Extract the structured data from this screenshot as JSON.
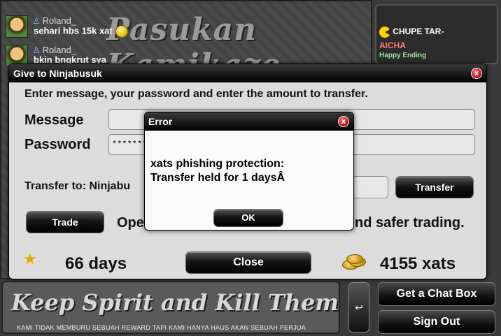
{
  "chat": {
    "banner": "Pasukan Kamikaze",
    "messages": [
      {
        "name": "Roland_",
        "text": "sehari hbs 15k xat"
      },
      {
        "name": "Roland_",
        "text": "bkin bngkrut sya"
      }
    ]
  },
  "user_list": {
    "row1": "CHUPE  TAR-",
    "row2": "AICHA",
    "row3": "Happy Ending"
  },
  "bottom": {
    "banner": "Keep Spirit and Kill Them AlL",
    "strip": "KAMI TIDAK MEMBURU  SEBUAH REWARD TAPI KAMI HANYA HAUS AKAN SEBUAH PERJUA",
    "return_icon": "↩",
    "get_chat_box": "Get a Chat Box",
    "sign_out": "Sign Out"
  },
  "give_dialog": {
    "title": "Give to Ninjabusuk",
    "instructions": "Enter message, your password and enter the amount to transfer.",
    "message_label": "Message",
    "message_value": "",
    "password_label": "Password",
    "password_value": "**********",
    "transfer_to_label": "Transfer to: Ninjabu",
    "transfer_button": "Transfer",
    "trade_button": "Trade",
    "trade_text_left": "Ope",
    "trade_text_right": "nd safer trading.",
    "days": "66 days",
    "close_button": "Close",
    "xats": "4155 xats",
    "close_icon": "x"
  },
  "error_dialog": {
    "title": "Error",
    "line1": "xats phishing protection:",
    "line2": "Transfer held for 1 daysÂ",
    "ok_button": "OK",
    "close_icon": "x"
  },
  "colors": {
    "dialog_bg": "#dcdcdc",
    "title_bar": "#000000",
    "close_red": "#c00000",
    "star_gold": "#e0b000"
  }
}
